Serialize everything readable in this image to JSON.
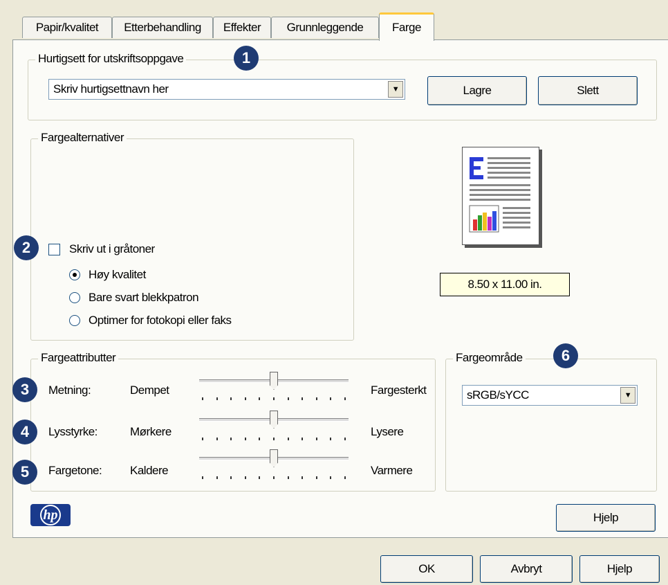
{
  "tabs": [
    "Papir/kvalitet",
    "Etterbehandling",
    "Effekter",
    "Grunnleggende",
    "Farge"
  ],
  "quickset": {
    "legend": "Hurtigsett for utskriftsoppgave",
    "combo_value": "Skriv hurtigsettnavn her",
    "save_label": "Lagre",
    "delete_label": "Slett",
    "badge": "1"
  },
  "color_options": {
    "legend": "Fargealternativer",
    "grayscale_label": "Skriv ut i gråtoner",
    "grayscale_checked": false,
    "badge": "2",
    "radios": [
      {
        "label": "Høy kvalitet",
        "selected": true
      },
      {
        "label": "Bare svart blekkpatron",
        "selected": false
      },
      {
        "label": "Optimer for fotokopi eller faks",
        "selected": false
      }
    ]
  },
  "preview": {
    "paper_size": "8.50 x 11.00 in."
  },
  "color_attributes": {
    "legend": "Fargeattributter",
    "sliders": [
      {
        "badge": "3",
        "name": "Metning:",
        "low": "Dempet",
        "high": "Fargesterkt",
        "value": 0.5
      },
      {
        "badge": "4",
        "name": "Lysstyrke:",
        "low": "Mørkere",
        "high": "Lysere",
        "value": 0.5
      },
      {
        "badge": "5",
        "name": "Fargetone:",
        "low": "Kaldere",
        "high": "Varmere",
        "value": 0.5
      }
    ]
  },
  "color_space": {
    "legend": "Fargeområde",
    "badge": "6",
    "value": "sRGB/sYCC"
  },
  "help_inner": "Hjelp",
  "footer": {
    "ok": "OK",
    "cancel": "Avbryt",
    "help": "Hjelp"
  },
  "logo_text": "hp",
  "colors": {
    "badge": "#1f3b73",
    "tab_highlight": "#ffc83c",
    "tooltip_bg": "#ffffe1"
  }
}
